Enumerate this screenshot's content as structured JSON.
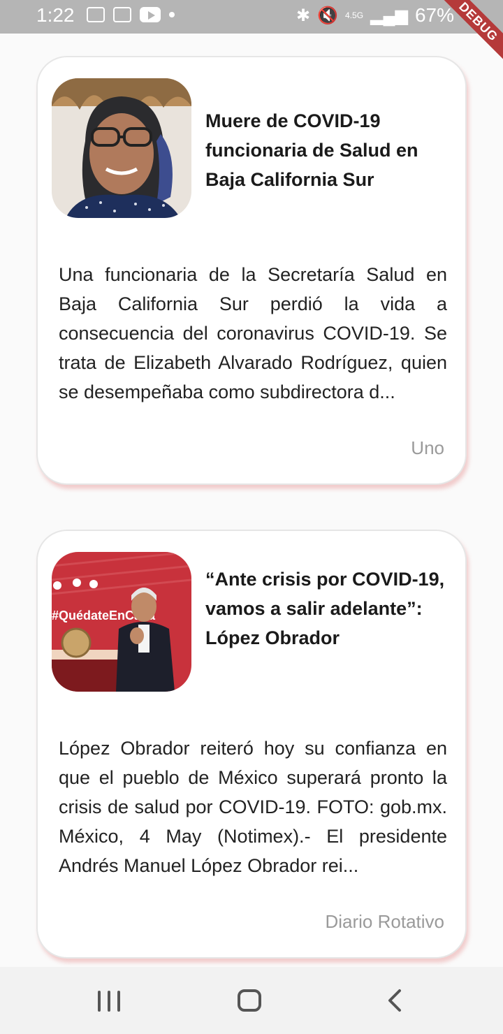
{
  "status_bar": {
    "time": "1:22",
    "network": "4.5G",
    "battery": "67%",
    "debug_label": "DEBUG",
    "icons_left": [
      "gmail-icon",
      "news-icon",
      "youtube-icon",
      "dot-icon"
    ],
    "icons_right": [
      "bluetooth-icon",
      "mute-icon",
      "network-icon",
      "signal-icon"
    ]
  },
  "articles": [
    {
      "title": "Muere de COVID-19 funcionaria de Salud en Baja California Sur",
      "body": "Una funcionaria de la Secretaría Salud en Baja California Sur perdió la vida a consecuencia del coronavirus COVID-19. Se trata de Elizabeth Alvarado Rodríguez, quien se desempeñaba como subdirectora d...",
      "source": "Uno"
    },
    {
      "title": "“Ante crisis por COVID-19, vamos a salir adelante”: López Obrador",
      "body": "López Obrador reiteró hoy su confianza en que el pueblo de México superará pronto la crisis de salud por COVID-19. FOTO: gob.mx. México, 4 May (Notimex).- El presidente Andrés Manuel López Obrador rei...",
      "source": "Diario Rotativo"
    }
  ],
  "thumb_2_text": "#QuédateEnCasa",
  "nav": {
    "icons": [
      "recents-icon",
      "home-icon",
      "back-icon"
    ]
  }
}
